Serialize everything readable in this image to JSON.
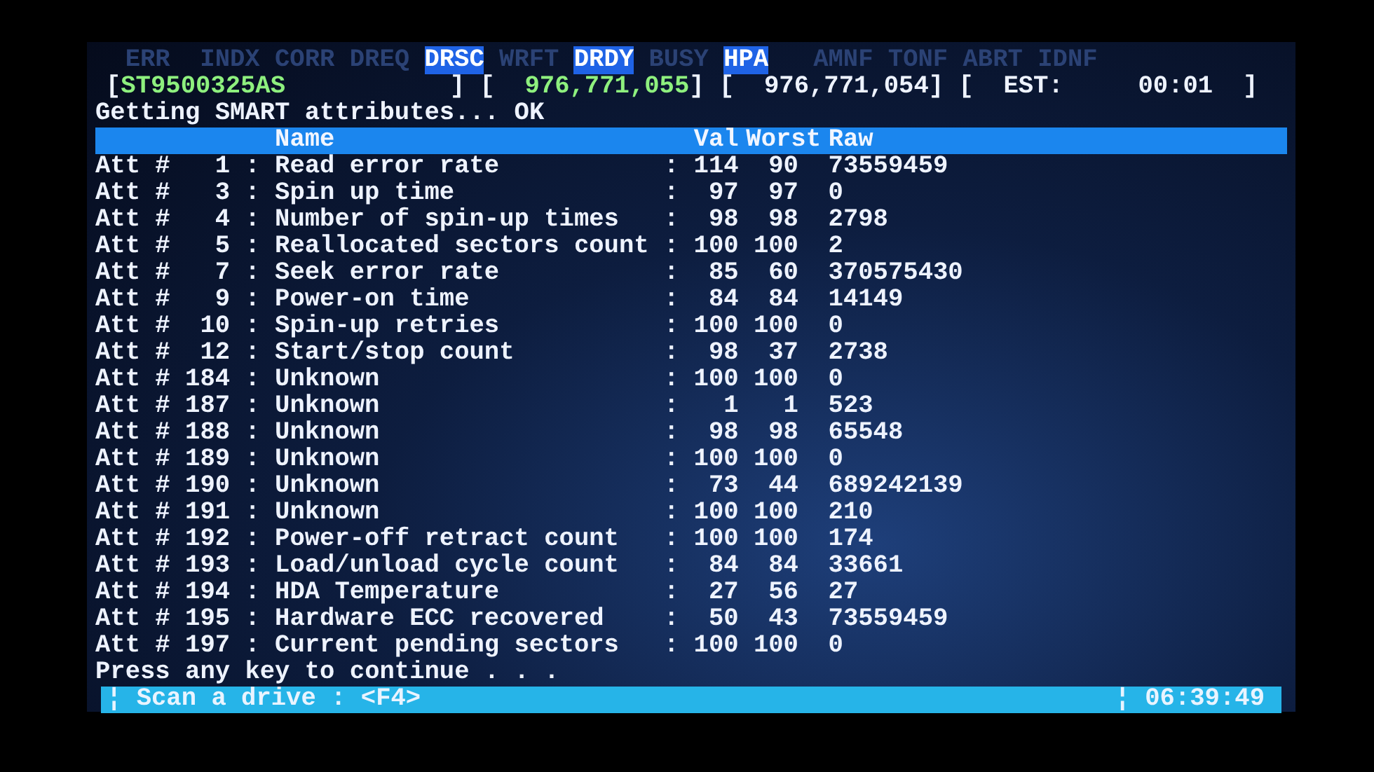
{
  "flags": [
    {
      "text": "ERR",
      "on": false
    },
    {
      "text": "INDX",
      "on": false
    },
    {
      "text": "CORR",
      "on": false
    },
    {
      "text": "DREQ",
      "on": false
    },
    {
      "text": "DRSC",
      "on": true
    },
    {
      "text": "WRFT",
      "on": false
    },
    {
      "text": "DRDY",
      "on": true
    },
    {
      "text": "BUSY",
      "on": false
    },
    {
      "text": "HPA",
      "on": true
    },
    {
      "text": "AMNF",
      "on": false
    },
    {
      "text": "TONF",
      "on": false
    },
    {
      "text": "ABRT",
      "on": false
    },
    {
      "text": "IDNF",
      "on": false
    }
  ],
  "drive_info": [
    {
      "text": "[",
      "kind": "plain"
    },
    {
      "text": "ST9500325AS",
      "kind": "green"
    },
    {
      "text": "] [",
      "kind": "plain"
    },
    {
      "text": "976,771,055",
      "kind": "green"
    },
    {
      "text": "] [",
      "kind": "plain"
    },
    {
      "text": "976,771,054",
      "kind": "plain"
    },
    {
      "text": "] [",
      "kind": "plain"
    },
    {
      "text": "EST:",
      "kind": "plain"
    },
    {
      "text": "00:01",
      "kind": "plain"
    },
    {
      "text": "]",
      "kind": "plain"
    }
  ],
  "message": "Getting SMART attributes... OK",
  "table": {
    "columns": [
      "Name",
      "Val",
      "Worst",
      "Raw"
    ],
    "rows": [
      {
        "attribute": "Att #   1 :",
        "name": "Read error rate",
        "value": ": 114",
        "worst": "90",
        "raw": "73559459"
      },
      {
        "attribute": "Att #   3 :",
        "name": "Spin up time",
        "value": ":  97",
        "worst": "97",
        "raw": "0"
      },
      {
        "attribute": "Att #   4 :",
        "name": "Number of spin-up times",
        "value": ":  98",
        "worst": "98",
        "raw": "2798"
      },
      {
        "attribute": "Att #   5 :",
        "name": "Reallocated sectors count",
        "value": ": 100",
        "worst": "100",
        "raw": "2"
      },
      {
        "attribute": "Att #   7 :",
        "name": "Seek error rate",
        "value": ":  85",
        "worst": "60",
        "raw": "370575430"
      },
      {
        "attribute": "Att #   9 :",
        "name": "Power-on time",
        "value": ":  84",
        "worst": "84",
        "raw": "14149"
      },
      {
        "attribute": "Att #  10 :",
        "name": "Spin-up retries",
        "value": ": 100",
        "worst": "100",
        "raw": "0"
      },
      {
        "attribute": "Att #  12 :",
        "name": "Start/stop count",
        "value": ":  98",
        "worst": "37",
        "raw": "2738"
      },
      {
        "attribute": "Att # 184 :",
        "name": "Unknown",
        "value": ": 100",
        "worst": "100",
        "raw": "0"
      },
      {
        "attribute": "Att # 187 :",
        "name": "Unknown",
        "value": ":   1",
        "worst": "1",
        "raw": "523"
      },
      {
        "attribute": "Att # 188 :",
        "name": "Unknown",
        "value": ":  98",
        "worst": "98",
        "raw": "65548"
      },
      {
        "attribute": "Att # 189 :",
        "name": "Unknown",
        "value": ": 100",
        "worst": "100",
        "raw": "0"
      },
      {
        "attribute": "Att # 190 :",
        "name": "Unknown",
        "value": ":  73",
        "worst": "44",
        "raw": "689242139"
      },
      {
        "attribute": "Att # 191 :",
        "name": "Unknown",
        "value": ": 100",
        "worst": "100",
        "raw": "210"
      },
      {
        "attribute": "Att # 192 :",
        "name": "Power-off retract count",
        "value": ": 100",
        "worst": "100",
        "raw": "174"
      },
      {
        "attribute": "Att # 193 :",
        "name": "Load/unload cycle count",
        "value": ":  84",
        "worst": "84",
        "raw": "33661"
      },
      {
        "attribute": "Att # 194 :",
        "name": "HDA Temperature",
        "value": ":  27",
        "worst": "56",
        "raw": "27"
      },
      {
        "attribute": "Att # 195 :",
        "name": "Hardware ECC recovered",
        "value": ":  50",
        "worst": "43",
        "raw": "73559459"
      },
      {
        "attribute": "Att # 197 :",
        "name": "Current pending sectors",
        "value": ": 100",
        "worst": "100",
        "raw": "0"
      }
    ]
  },
  "prompt": "Press any key to continue . . .",
  "status_bar": {
    "left": "¦ Scan a drive : <F4>",
    "right": "¦ 06:39:49"
  }
}
